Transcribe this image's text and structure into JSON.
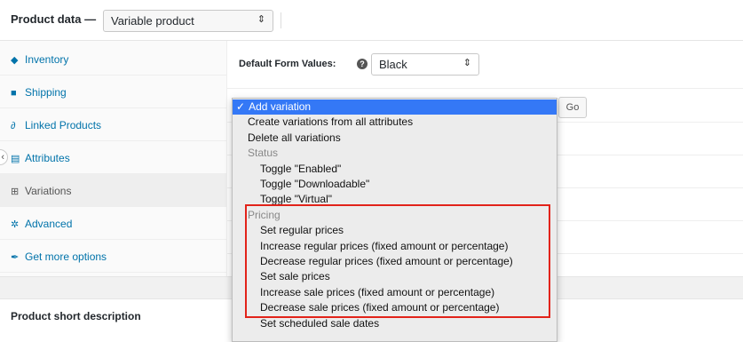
{
  "header": {
    "label": "Product data —",
    "product_type": "Variable product",
    "select_arrow": "⇕"
  },
  "tabs": [
    {
      "label": "Inventory",
      "icon": "tag-icon",
      "glyph": "◆",
      "active": false
    },
    {
      "label": "Shipping",
      "icon": "truck-icon",
      "glyph": "■",
      "active": false
    },
    {
      "label": "Linked Products",
      "icon": "link-icon",
      "glyph": "∂",
      "active": false
    },
    {
      "label": "Attributes",
      "icon": "list-icon",
      "glyph": "▤",
      "active": false
    },
    {
      "label": "Variations",
      "icon": "grid-icon",
      "glyph": "⊞",
      "active": true
    },
    {
      "label": "Advanced",
      "icon": "gear-icon",
      "glyph": "✲",
      "active": false
    },
    {
      "label": "Get more options",
      "icon": "plugin-icon",
      "glyph": "✒",
      "active": false
    }
  ],
  "defaults": {
    "label": "Default Form Values:",
    "help_glyph": "?",
    "color_value": "Black"
  },
  "go_button": "Go",
  "dropdown": {
    "check": "✓",
    "items": [
      {
        "label": "Add variation",
        "kind": "selected"
      },
      {
        "label": "Create variations from all attributes",
        "kind": "option"
      },
      {
        "label": "Delete all variations",
        "kind": "option"
      },
      {
        "label": "Status",
        "kind": "group"
      },
      {
        "label": "Toggle \"Enabled\"",
        "kind": "sub"
      },
      {
        "label": "Toggle \"Downloadable\"",
        "kind": "sub"
      },
      {
        "label": "Toggle \"Virtual\"",
        "kind": "sub"
      },
      {
        "label": "Pricing",
        "kind": "group"
      },
      {
        "label": "Set regular prices",
        "kind": "sub"
      },
      {
        "label": "Increase regular prices (fixed amount or percentage)",
        "kind": "sub"
      },
      {
        "label": "Decrease regular prices (fixed amount or percentage)",
        "kind": "sub"
      },
      {
        "label": "Set sale prices",
        "kind": "sub"
      },
      {
        "label": "Increase sale prices (fixed amount or percentage)",
        "kind": "sub"
      },
      {
        "label": "Decrease sale prices (fixed amount or percentage)",
        "kind": "sub"
      },
      {
        "label": "Set scheduled sale dates",
        "kind": "sub"
      }
    ]
  },
  "short_description": "Product short description",
  "colors": {
    "link": "#0073aa",
    "selected": "#3478f6",
    "highlight": "#e2231a"
  }
}
